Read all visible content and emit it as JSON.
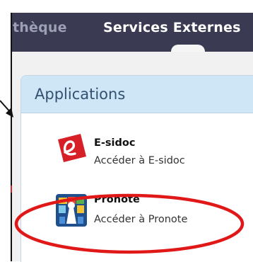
{
  "nav": {
    "items": [
      {
        "label": "thèque",
        "active": false
      },
      {
        "label": "Services Externes",
        "active": true
      }
    ]
  },
  "panel": {
    "title": "Applications"
  },
  "apps": [
    {
      "name": "E-sidoc",
      "description": "Accéder à E-sidoc",
      "icon": "esidoc-logo-icon"
    },
    {
      "name": "Pronote",
      "description": "Accéder à Pronote",
      "icon": "pronote-logo-icon"
    }
  ],
  "colors": {
    "nav_bg": "#3a3b52",
    "panel_header_bg": "#cfe6f7",
    "title_text": "#33516f",
    "esidoc_red": "#d61f26",
    "highlight_ellipse": "#e01818"
  }
}
